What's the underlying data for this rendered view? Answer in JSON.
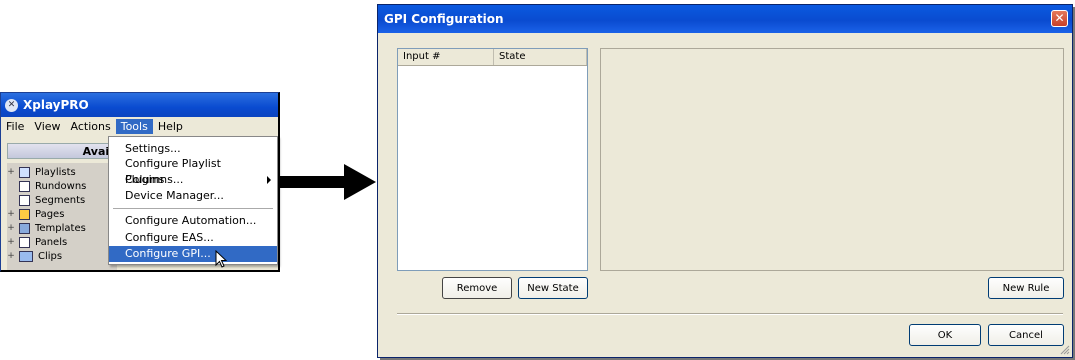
{
  "xplay": {
    "title": "XplayPRO",
    "menu": [
      "File",
      "View",
      "Actions",
      "Tools",
      "Help"
    ],
    "active_menu": "Tools",
    "panel_header": "Availabl",
    "tree": [
      "Playlists",
      "Rundowns",
      "Segments",
      "Pages",
      "Templates",
      "Panels",
      "Clips"
    ],
    "tools_menu": {
      "items": [
        "Settings...",
        "Configure Playlist Columns...",
        "Plugins",
        "Device Manager...",
        "Configure Automation...",
        "Configure EAS...",
        "Configure GPI..."
      ],
      "highlighted": "Configure GPI..."
    }
  },
  "gpi": {
    "title": "GPI Configuration",
    "columns": [
      "Input #",
      "State"
    ],
    "buttons": {
      "remove": "Remove",
      "new_state": "New State",
      "new_rule": "New Rule",
      "ok": "OK",
      "cancel": "Cancel"
    }
  },
  "colors": {
    "titlebar": "#0a4bd0",
    "highlight": "#316ac5",
    "dialog_bg": "#ece9d8"
  }
}
